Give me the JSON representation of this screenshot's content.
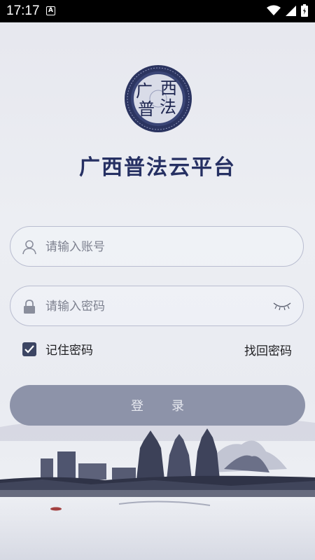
{
  "status_bar": {
    "time": "17:17",
    "a_badge": "A",
    "icons": [
      "wifi-icon",
      "signal-icon",
      "battery-icon"
    ]
  },
  "app": {
    "logo_chars": [
      "广",
      "西",
      "普",
      "法"
    ],
    "title": "广西普法云平台"
  },
  "form": {
    "account_placeholder": "请输入账号",
    "password_placeholder": "请输入密码",
    "remember_label": "记住密码",
    "remember_checked": true,
    "forgot_label": "找回密码",
    "login_label": "登录"
  },
  "colors": {
    "title": "#263063",
    "button": "#8d93a9",
    "checkbox": "#3c4563",
    "field_border": "#b9bdd0"
  }
}
